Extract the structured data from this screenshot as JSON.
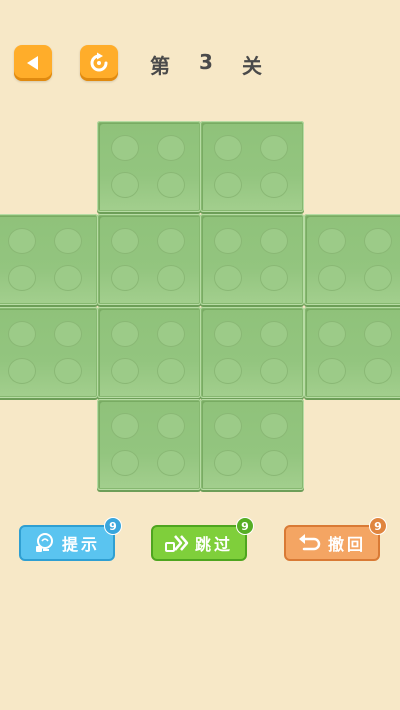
{
  "header": {
    "level_prefix": "第",
    "level_number": "3",
    "level_suffix": "关",
    "back_icon": "triangle-left-icon",
    "restart_icon": "restart-icon"
  },
  "board": {
    "tile_color": "#93c57f",
    "layout": [
      [
        0,
        1,
        1,
        0
      ],
      [
        1,
        1,
        1,
        1
      ],
      [
        1,
        1,
        1,
        1
      ],
      [
        0,
        1,
        1,
        0
      ]
    ]
  },
  "actions": {
    "hint": {
      "label": "提示",
      "count": "9",
      "icon": "lightbulb-icon",
      "color": "#5ac4f0"
    },
    "skip": {
      "label": "跳过",
      "count": "9",
      "icon": "fast-forward-icon",
      "color": "#7fcf3b"
    },
    "undo": {
      "label": "撤回",
      "count": "9",
      "icon": "undo-arrow-icon",
      "color": "#f4a563"
    }
  }
}
